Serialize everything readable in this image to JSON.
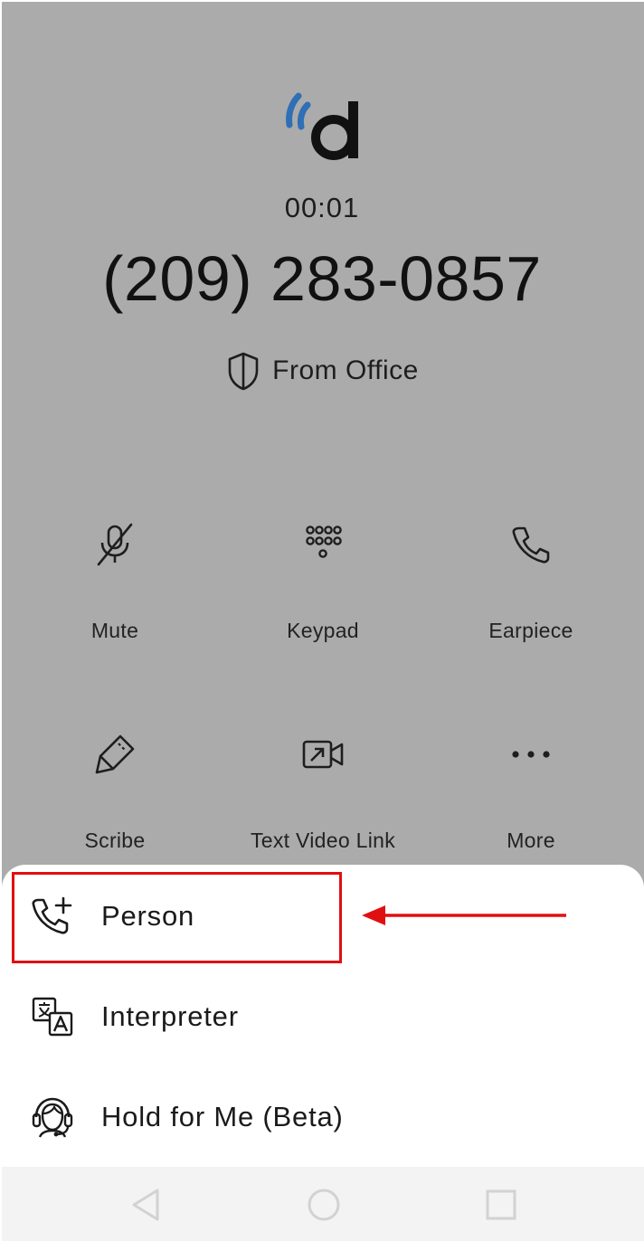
{
  "call": {
    "timer": "00:01",
    "number": "(209) 283-0857",
    "caller_id": "From Office"
  },
  "actions": [
    {
      "label": "Mute",
      "icon": "mic-off-icon"
    },
    {
      "label": "Keypad",
      "icon": "keypad-icon"
    },
    {
      "label": "Earpiece",
      "icon": "phone-icon"
    },
    {
      "label": "Scribe",
      "icon": "pen-icon"
    },
    {
      "label": "Text Video Link",
      "icon": "video-link-icon"
    },
    {
      "label": "More",
      "icon": "more-icon"
    }
  ],
  "sheet": {
    "items": [
      {
        "label": "Person",
        "icon": "phone-add-icon"
      },
      {
        "label": "Interpreter",
        "icon": "translate-icon"
      },
      {
        "label": "Hold for Me (Beta)",
        "icon": "headset-agent-icon"
      }
    ]
  },
  "annotation": {
    "highlight_color": "#e01010"
  },
  "colors": {
    "logo_blue": "#2f6fb5",
    "overlay": "#ababab"
  }
}
